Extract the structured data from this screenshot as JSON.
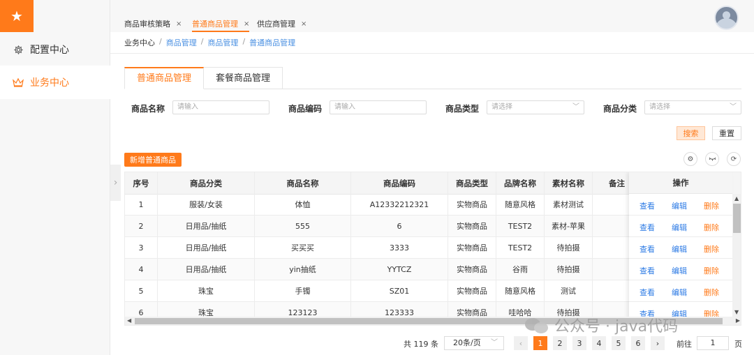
{
  "sidebar": {
    "logo_icon": "star-icon",
    "items": [
      {
        "label": "配置中心",
        "icon": "gear-icon",
        "active": false
      },
      {
        "label": "业务中心",
        "icon": "crown-icon",
        "active": true
      }
    ]
  },
  "tabs": [
    {
      "label": "商品审核策略",
      "close": "×",
      "active": false
    },
    {
      "label": "普通商品管理",
      "close": "×",
      "active": true
    },
    {
      "label": "供应商管理",
      "close": "×",
      "active": false
    }
  ],
  "breadcrumb": [
    "业务中心",
    "商品管理",
    "商品管理",
    "普通商品管理"
  ],
  "breadcrumb_sep": "/",
  "subtabs": [
    {
      "label": "普通商品管理",
      "active": true
    },
    {
      "label": "套餐商品管理",
      "active": false
    }
  ],
  "filters": [
    {
      "label": "商品名称",
      "placeholder": "请输入",
      "type": "input"
    },
    {
      "label": "商品编码",
      "placeholder": "请输入",
      "type": "input"
    },
    {
      "label": "商品类型",
      "placeholder": "请选择",
      "type": "select"
    },
    {
      "label": "商品分类",
      "placeholder": "请选择",
      "type": "select"
    }
  ],
  "buttons": {
    "search": "搜索",
    "reset": "重置",
    "add": "新增普通商品"
  },
  "toolbar_icons": [
    "settings-icon",
    "eye-icon",
    "refresh-icon"
  ],
  "table": {
    "columns": [
      "序号",
      "商品分类",
      "商品名称",
      "商品编码",
      "商品类型",
      "品牌名称",
      "素材名称",
      "备注"
    ],
    "op_header": "操作",
    "rows": [
      [
        "1",
        "服装/女装",
        "体恤",
        "A12332212321",
        "实物商品",
        "随意风格",
        "素材测试",
        ""
      ],
      [
        "2",
        "日用品/抽纸",
        "555",
        "6",
        "实物商品",
        "TEST2",
        "素材-苹果",
        ""
      ],
      [
        "3",
        "日用品/抽纸",
        "买买买",
        "3333",
        "实物商品",
        "TEST2",
        "待拍摄",
        ""
      ],
      [
        "4",
        "日用品/抽纸",
        "yin抽纸",
        "YYTCZ",
        "实物商品",
        "谷雨",
        "待拍摄",
        ""
      ],
      [
        "5",
        "珠宝",
        "手镯",
        "SZ01",
        "实物商品",
        "随意风格",
        "测试",
        ""
      ],
      [
        "6",
        "珠宝",
        "123123",
        "123333",
        "实物商品",
        "哇哈哈",
        "待拍摄",
        ""
      ]
    ],
    "actions": {
      "view": "查看",
      "edit": "编辑",
      "delete": "删除"
    }
  },
  "pagination": {
    "total": "共 119 条",
    "page_size": "20条/页",
    "pages": [
      "1",
      "2",
      "3",
      "4",
      "5",
      "6"
    ],
    "current": 1,
    "goto_label": "前往",
    "goto_value": "1",
    "page_suffix": "页"
  },
  "watermark": "公众号 · java代码",
  "colors": {
    "accent": "#ff7a1a",
    "link": "#2d7be5"
  }
}
